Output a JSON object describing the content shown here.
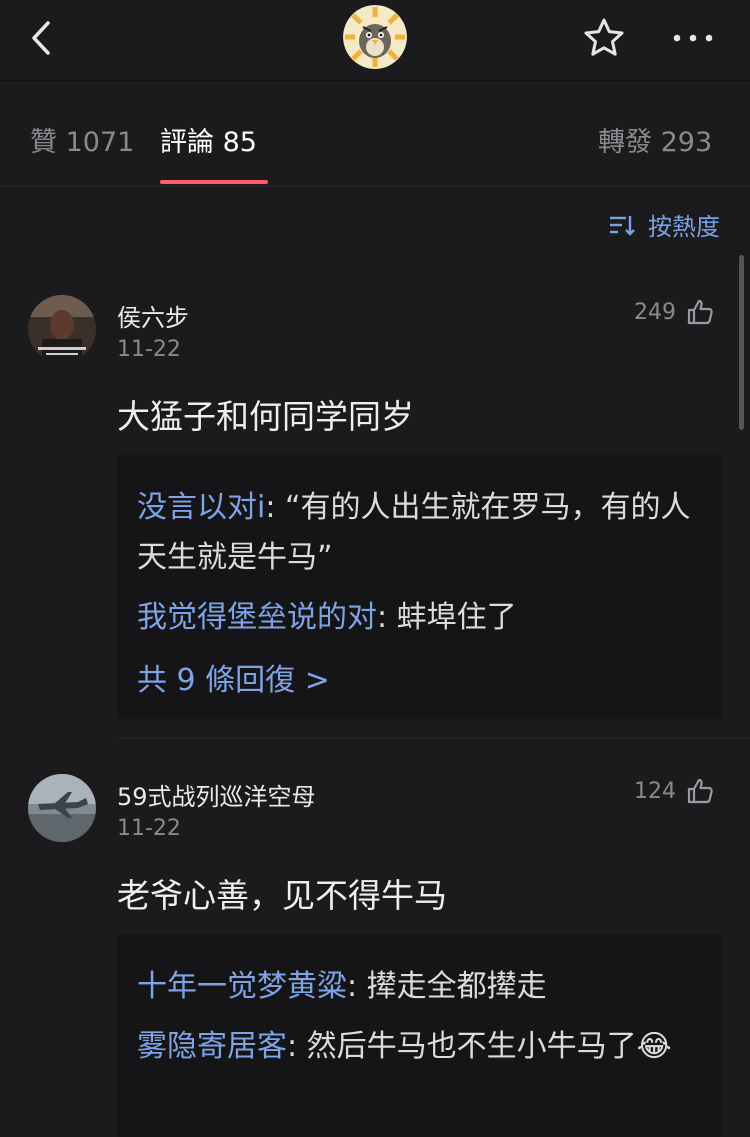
{
  "header": {
    "back_icon": "chevron-left-icon",
    "avatar_icon": "bird-avatar",
    "favorite_icon": "star-outline-icon",
    "more_icon": "more-dots-icon"
  },
  "tabs": [
    {
      "label": "贊",
      "count": "1071"
    },
    {
      "label": "評論",
      "count": "85"
    },
    {
      "label": "轉發",
      "count": "293"
    }
  ],
  "sort": {
    "label": "按熱度",
    "icon": "sort-icon"
  },
  "comments": [
    {
      "author": "侯六步",
      "date": "11-22",
      "likes": "249",
      "body": "大猛子和何同学同岁",
      "replies": [
        {
          "author": "没言以对i",
          "sep": ": ",
          "text": "“有的人出生就在罗马，有的人天生就是牛马”"
        },
        {
          "author": "我觉得堡垒说的对",
          "sep": ": ",
          "text": "蚌埠住了"
        }
      ],
      "more_replies": "共 9 條回復 >"
    },
    {
      "author": "59式战列巡洋空母",
      "date": "11-22",
      "likes": "124",
      "body": "老爷心善，见不得牛马",
      "replies": [
        {
          "author": "十年一觉梦黄粱",
          "sep": ": ",
          "text": "撵走全都撵走"
        },
        {
          "author": "雾隐寄居客",
          "sep": ": ",
          "text": "然后牛马也不生小牛马了",
          "emoji": "😂"
        }
      ]
    }
  ]
}
